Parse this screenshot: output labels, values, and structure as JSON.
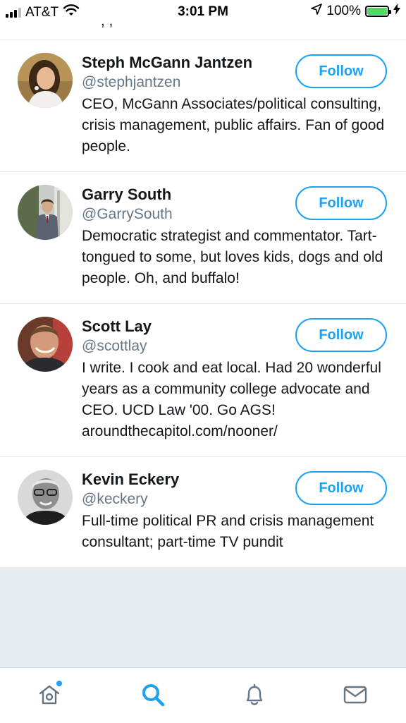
{
  "status_bar": {
    "carrier": "AT&T",
    "time": "3:01 PM",
    "battery_percent": "100%",
    "battery_level": 1.0
  },
  "cut_row": {
    "text": "···  ,      ,  ·  · ·"
  },
  "accounts": [
    {
      "name": "Steph McGann Jantzen",
      "handle": "@stephjantzen",
      "bio": "CEO, McGann Associates/political consulting, crisis management, public affairs. Fan of good people.",
      "follow_label": "Follow"
    },
    {
      "name": "Garry South",
      "handle": "@GarrySouth",
      "bio": "Democratic strategist and commentator. Tart-tongued to some, but loves kids, dogs and old people. Oh, and buffalo!",
      "follow_label": "Follow"
    },
    {
      "name": "Scott Lay",
      "handle": "@scottlay",
      "bio": "I write. I cook and eat local. Had 20 wonderful years as a community college advocate and CEO. UCD Law '00. Go AGS! aroundthecapitol.com/nooner/",
      "follow_label": "Follow"
    },
    {
      "name": "Kevin Eckery",
      "handle": "@keckery",
      "bio": "Full-time political PR and crisis management consultant; part-time TV pundit",
      "follow_label": "Follow"
    }
  ],
  "tabs": [
    {
      "icon": "home-icon",
      "active": false,
      "has_notification_dot": true
    },
    {
      "icon": "search-icon",
      "active": true
    },
    {
      "icon": "bell-icon",
      "active": false
    },
    {
      "icon": "mail-icon",
      "active": false
    }
  ],
  "colors": {
    "accent": "#1da1f2",
    "text": "#14171a",
    "secondary_text": "#657786",
    "divider": "#e1e8ed",
    "background": "#e6ecf0",
    "battery": "#4cd964"
  }
}
